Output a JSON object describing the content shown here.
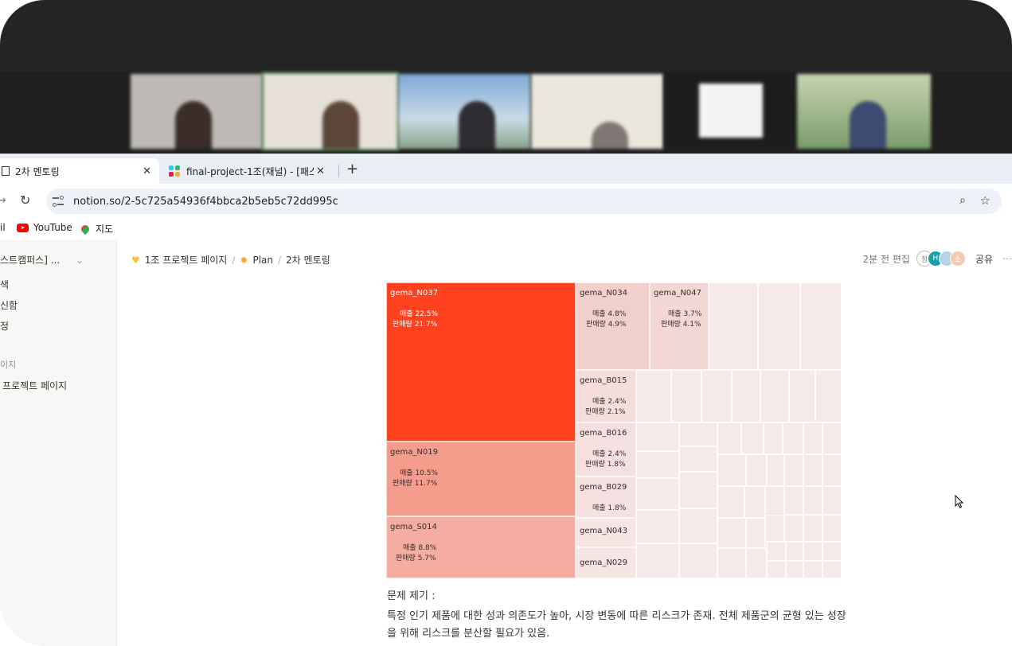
{
  "browser": {
    "tabs": [
      {
        "label": "2차 멘토링",
        "close": "✕"
      },
      {
        "label": "final-project-1조(채널) - [패스",
        "close": "✕"
      }
    ],
    "new_tab": "+",
    "url": "notion.so/2-5c725a54936f4bbca2b5eb5c72dd995c",
    "bookmarks": [
      {
        "label": "il"
      },
      {
        "label": "YouTube"
      },
      {
        "label": "지도"
      }
    ]
  },
  "sidebar": {
    "workspace": "스트캠퍼스] ...",
    "items": [
      "색",
      "신함",
      "정"
    ],
    "section": "이지",
    "page": "프로젝트 페이지"
  },
  "page": {
    "breadcrumb": [
      "1조 프로젝트 페이지",
      "Plan",
      "2차 멘토링"
    ],
    "edited": "2분 전 편집",
    "share": "공유",
    "avatars": [
      "정",
      "H",
      "",
      "소"
    ],
    "problem_title": "문제 제기 :",
    "problem_body": "특정 인기 제품에 대한 성과 의존도가 높아, 시장 변동에 따른 리스크가 존재. 전체 제품군의 균형 있는 성장을 위해 리스크를 분산할 필요가 있음."
  },
  "chart_data": {
    "type": "heatmap",
    "subtype": "treemap",
    "items": [
      {
        "name": "gema_N037",
        "sales": "매출 22.5%",
        "volume": "판매량 21.7%",
        "color": "#ff4120"
      },
      {
        "name": "gema_N019",
        "sales": "매출 10.5%",
        "volume": "판매량 11.7%",
        "color": "#f59d8d"
      },
      {
        "name": "gema_S014",
        "sales": "매출 8.8%",
        "volume": "판매량 5.7%",
        "color": "#f4ada0"
      },
      {
        "name": "gema_N034",
        "sales": "매출 4.8%",
        "volume": "판매량 4.9%",
        "color": "#f1cfca"
      },
      {
        "name": "gema_N047",
        "sales": "매출 3.7%",
        "volume": "판매량 4.1%",
        "color": "#f3d7d4"
      },
      {
        "name": "gema_B015",
        "sales": "매출 2.4%",
        "volume": "판매량 2.1%",
        "color": "#f4dddb"
      },
      {
        "name": "gema_B016",
        "sales": "매출 2.4%",
        "volume": "판매량 1.8%",
        "color": "#f4e0de"
      },
      {
        "name": "gema_B029",
        "sales": "매출 1.8%",
        "volume": "",
        "color": "#f5e2e0"
      },
      {
        "name": "gema_N043",
        "sales": "",
        "volume": "",
        "color": "#f5e5e3"
      },
      {
        "name": "gema_N029",
        "sales": "",
        "volume": "",
        "color": "#f5e6e4"
      }
    ]
  }
}
